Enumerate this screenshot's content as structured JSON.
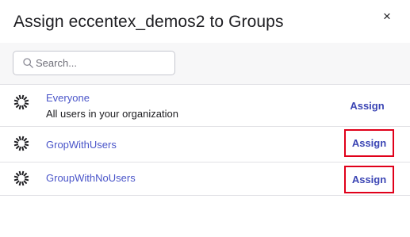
{
  "dialog": {
    "title": "Assign eccentex_demos2 to Groups",
    "close_label": "×"
  },
  "search": {
    "placeholder": "Search...",
    "value": ""
  },
  "groups": [
    {
      "name": "Everyone",
      "description": "All users in your organization",
      "action": "Assign",
      "highlighted": false
    },
    {
      "name": "GropWithUsers",
      "description": "",
      "action": "Assign",
      "highlighted": true
    },
    {
      "name": "GroupWithNoUsers",
      "description": "",
      "action": "Assign",
      "highlighted": true
    }
  ],
  "icons": {
    "group": "okta-sunburst-icon",
    "search": "search-icon",
    "close": "close-icon"
  },
  "colors": {
    "link": "#4a55c9",
    "assign": "#3b45b4",
    "highlight_border": "#e0001a",
    "search_band": "#f7f7f8"
  }
}
